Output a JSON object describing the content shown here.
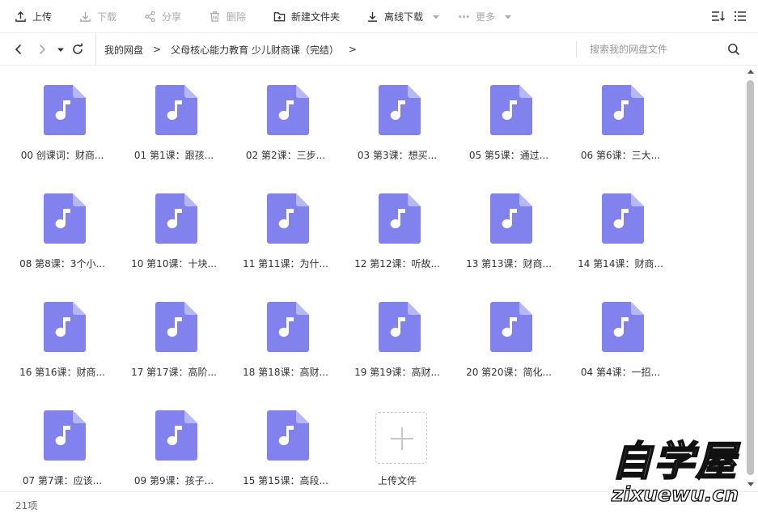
{
  "toolbar": {
    "upload": "上传",
    "download": "下载",
    "share": "分享",
    "delete": "删除",
    "new_folder": "新建文件夹",
    "offline_download": "离线下载",
    "more": "更多"
  },
  "nav": {
    "breadcrumbs": [
      "我的网盘",
      "父母核心能力教育 少儿财商课（完结）"
    ],
    "separator": ">"
  },
  "search": {
    "placeholder": "搜索我的网盘文件"
  },
  "colors": {
    "file_icon": "#8182ed",
    "file_icon_fold": "#b6b7f5"
  },
  "files": [
    "00 创课词：财商...",
    "01 第1课：跟孩...",
    "02 第2课：三步...",
    "03 第3课：想买...",
    "05 第5课：通过...",
    "06 第6课：三大...",
    "08 第8课：3个小...",
    "10 第10课：十块...",
    "11 第11课：为什...",
    "12 第12课：听故...",
    "13 第13课：财商...",
    "14 第14课：财商...",
    "16 第16课：财商...",
    "17 第17课：高阶...",
    "18 第18课：高财...",
    "19 第19课：高财...",
    "20 第20课：简化...",
    "04 第4课：一招...",
    "07 第7课：应该...",
    "09 第9课：孩子...",
    "15 第15课：高段..."
  ],
  "upload_tile": {
    "label": "上传文件"
  },
  "status": {
    "count": "21项"
  },
  "watermark": {
    "title": "自学屋",
    "url": "zixuewu.cn"
  }
}
